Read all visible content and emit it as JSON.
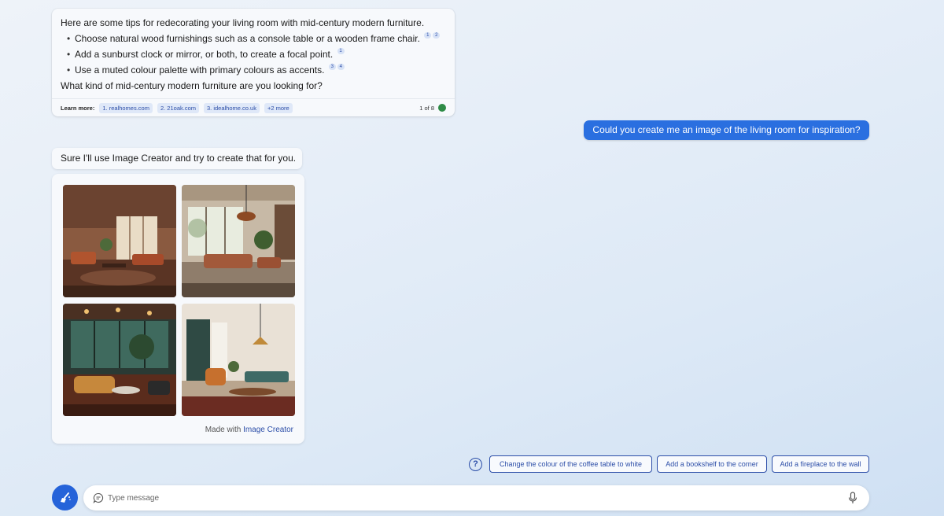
{
  "bot_message_1": {
    "intro": "Here are some tips for redecorating your living room with mid-century modern furniture.",
    "tips": [
      {
        "text": "Choose natural wood furnishings such as a console table or a wooden frame chair.",
        "cites": [
          "1",
          "2"
        ]
      },
      {
        "text": "Add a sunburst clock or mirror, or both, to create a focal point.",
        "cites": [
          "1"
        ]
      },
      {
        "text": "Use a muted colour palette with primary colours as accents.",
        "cites": [
          "3",
          "4"
        ]
      }
    ],
    "question": "What kind of mid-century modern furniture are you looking for?",
    "learn_more": {
      "label": "Learn more:",
      "links": [
        "1. realhomes.com",
        "2. 21oak.com",
        "3. idealhome.co.uk",
        "+2 more"
      ],
      "count": "1 of 8"
    }
  },
  "user_message": "Could you create me an image of the living room for inspiration?",
  "bot_message_2": {
    "text": "Sure I'll use Image Creator and try to create that for you.",
    "made_with_prefix": "Made with",
    "made_with_link": "Image Creator"
  },
  "suggestions": [
    "Change the colour of the coffee table to white",
    "Add a bookshelf to the corner",
    "Add a fireplace to the wall"
  ],
  "input": {
    "placeholder": "Type message"
  },
  "icons": {
    "help": "help-icon",
    "new_topic": "broom-icon",
    "compose": "chat-bubble-icon",
    "mic": "microphone-icon"
  },
  "colors": {
    "accent": "#2a6fe0",
    "link": "#2c4ea8",
    "status_dot": "#2e8b46"
  }
}
